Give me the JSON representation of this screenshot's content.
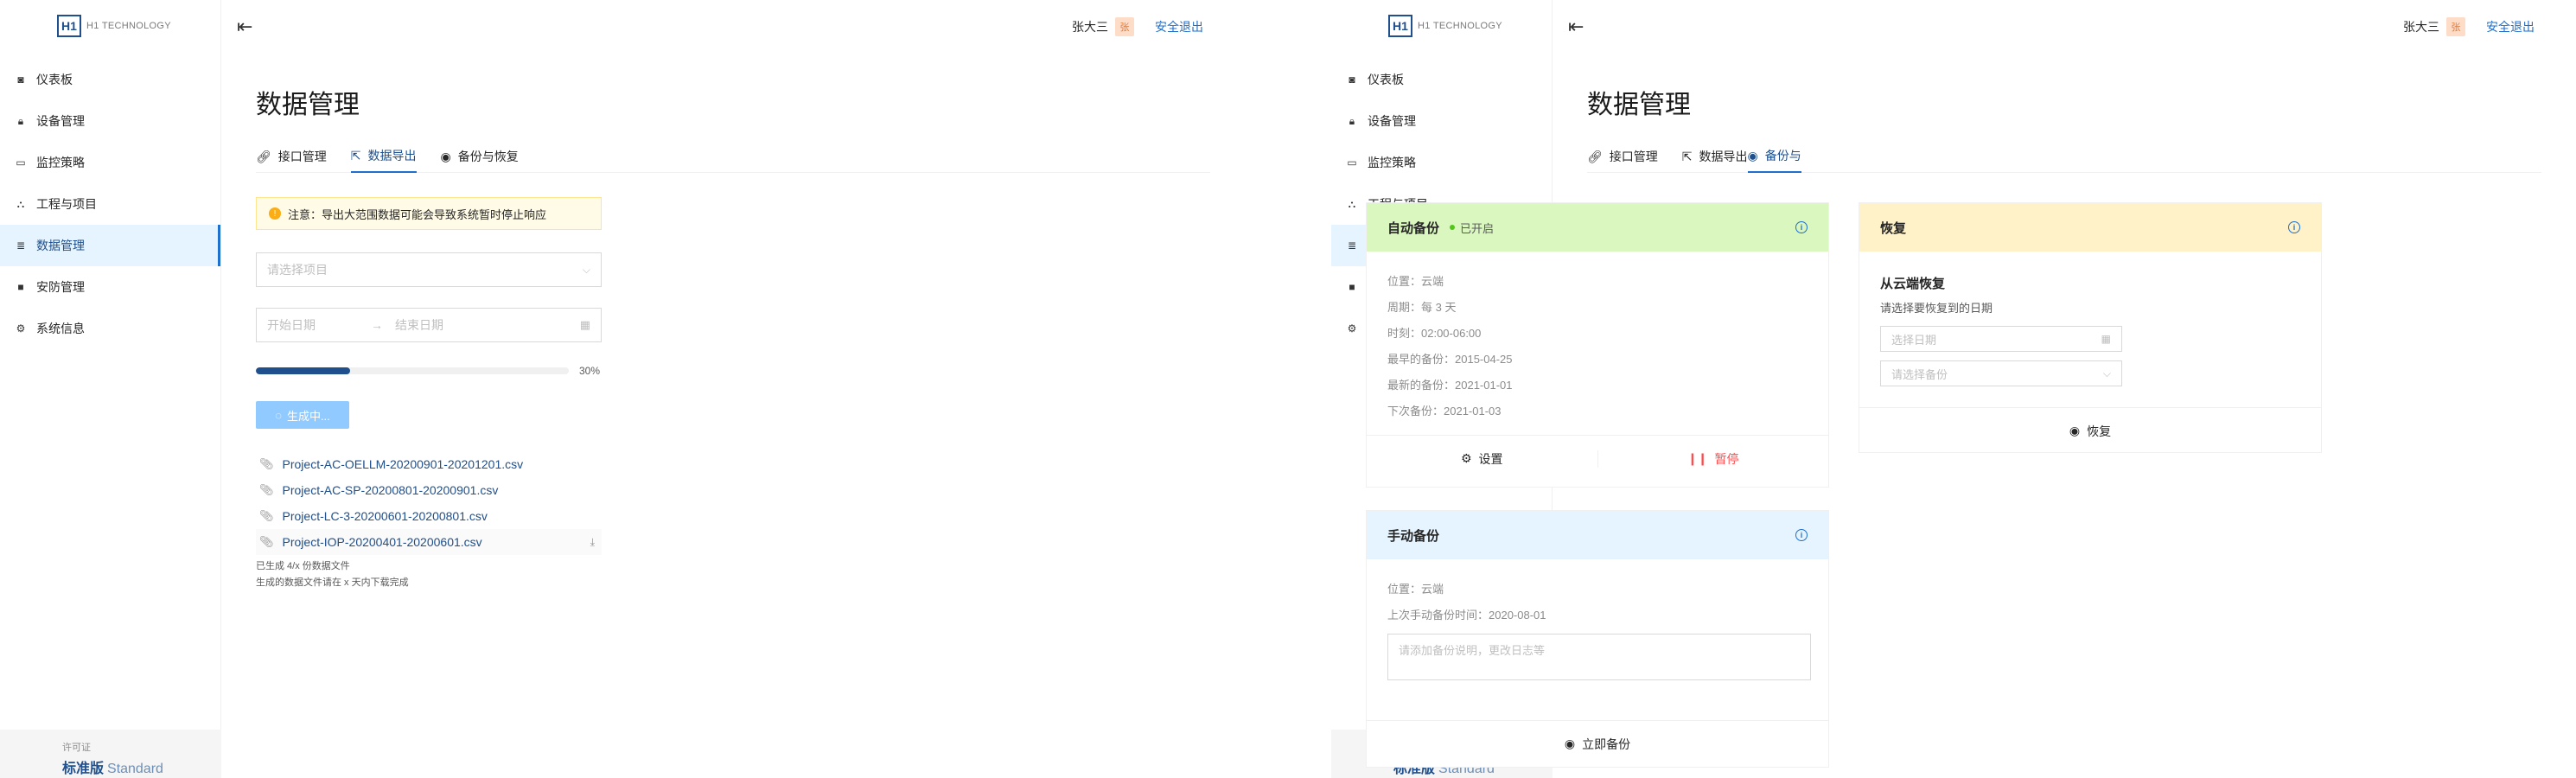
{
  "brand": {
    "mark": "H1",
    "name": "H1 TECHNOLOGY"
  },
  "sidebar": {
    "items": [
      {
        "label": "仪表板",
        "icon": "dashboard-icon"
      },
      {
        "label": "设备管理",
        "icon": "lock-icon"
      },
      {
        "label": "监控策略",
        "icon": "monitor-icon"
      },
      {
        "label": "工程与项目",
        "icon": "hierarchy-icon"
      },
      {
        "label": "数据管理",
        "icon": "list-icon"
      },
      {
        "label": "安防管理",
        "icon": "camera-icon"
      },
      {
        "label": "系统信息",
        "icon": "gear-icon"
      }
    ],
    "active_index": 4
  },
  "license": {
    "label": "许可证",
    "edition": "标准版",
    "edition_en": "Standard"
  },
  "topbar": {
    "username": "张大三",
    "avatar_text": "张",
    "logout": "安全退出"
  },
  "page": {
    "title": "数据管理"
  },
  "tabs": [
    {
      "label": "接口管理",
      "icon": "link-icon"
    },
    {
      "label": "数据导出",
      "icon": "export-icon"
    },
    {
      "label": "备份与恢复",
      "icon": "eye-icon"
    }
  ],
  "tabs_right_visible": [
    "接口管理",
    "数据导出",
    "备份与"
  ],
  "export": {
    "alert": "注意：导出大范围数据可能会导致系统暂时停止响应",
    "project_placeholder": "请选择项目",
    "start_placeholder": "开始日期",
    "end_placeholder": "结束日期",
    "progress": 30,
    "progress_text": "30%",
    "generate_button": "生成中...",
    "files": [
      "Project-AC-OELLM-20200901-20201201.csv",
      "Project-AC-SP-20200801-20200901.csv",
      "Project-LC-3-20200601-20200801.csv",
      "Project-IOP-20200401-20200601.csv"
    ],
    "note1": "已生成 4/x 份数据文件",
    "note2": "生成的数据文件请在 x 天内下载完成"
  },
  "auto_backup": {
    "title": "自动备份",
    "status": "已开启",
    "lines": [
      "位置：云端",
      "周期：每 3 天",
      "时刻：02:00-06:00",
      "最早的备份：2015-04-25",
      "最新的备份：2021-01-01",
      "下次备份：2021-01-03"
    ],
    "settings_button": "设置",
    "pause_button": "暂停"
  },
  "manual_backup": {
    "title": "手动备份",
    "lines": [
      "位置：云端",
      "上次手动备份时间：2020-08-01"
    ],
    "textarea_placeholder": "请添加备份说明，更改日志等",
    "button": "立即备份"
  },
  "restore": {
    "title": "恢复",
    "subtitle": "从云端恢复",
    "desc": "请选择要恢复到的日期",
    "date_placeholder": "选择日期",
    "backup_placeholder": "请选择备份",
    "button": "恢复"
  },
  "colors": {
    "primary": "#1f4f8c",
    "link": "#1f6fcc",
    "active_bg": "#e6f4ff",
    "danger": "#ff4d4f",
    "success": "#52c41a"
  }
}
